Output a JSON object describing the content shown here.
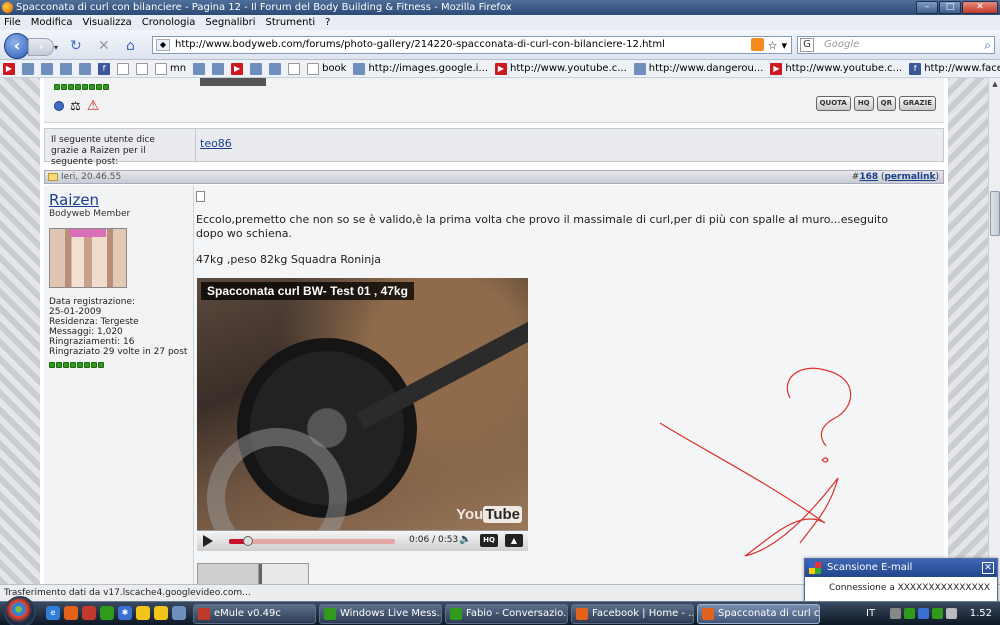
{
  "window": {
    "title": "Spacconata di curl con bilanciere - Pagina 12 - Il Forum del Body Building & Fitness - Mozilla Firefox",
    "controls": [
      "–",
      "□",
      "✕"
    ]
  },
  "menu": [
    {
      "label": "File",
      "key": "F"
    },
    {
      "label": "Modifica",
      "key": "M"
    },
    {
      "label": "Visualizza",
      "key": "V"
    },
    {
      "label": "Cronologia",
      "key": "C"
    },
    {
      "label": "Segnalibri",
      "key": "S"
    },
    {
      "label": "Strumenti",
      "key": "t"
    },
    {
      "label": "?",
      "key": "?"
    }
  ],
  "nav": {
    "url": "http://www.bodyweb.com/forums/photo-gallery/214220-spacconata-di-curl-con-bilanciere-12.html",
    "search_placeholder": "Google",
    "search_engine_icon": "G"
  },
  "bookmarks": [
    {
      "label": "",
      "icon": "yt"
    },
    {
      "label": "",
      "icon": "gen"
    },
    {
      "label": "",
      "icon": "gen"
    },
    {
      "label": "",
      "icon": "gen"
    },
    {
      "label": "",
      "icon": "gen"
    },
    {
      "label": "",
      "icon": "fb"
    },
    {
      "label": "",
      "icon": "page"
    },
    {
      "label": "",
      "icon": "page"
    },
    {
      "label": "mn",
      "icon": "page"
    },
    {
      "label": "",
      "icon": "gen"
    },
    {
      "label": "",
      "icon": "gen"
    },
    {
      "label": "",
      "icon": "yt"
    },
    {
      "label": "",
      "icon": "gen"
    },
    {
      "label": "",
      "icon": "gen"
    },
    {
      "label": "",
      "icon": "page"
    },
    {
      "label": "book",
      "icon": "page"
    },
    {
      "label": "http://images.google.i...",
      "icon": "gen"
    },
    {
      "label": "http://www.youtube.c...",
      "icon": "yt"
    },
    {
      "label": "http://www.dangerou...",
      "icon": "gen"
    },
    {
      "label": "http://www.youtube.c...",
      "icon": "yt"
    },
    {
      "label": "http://www.facebook....",
      "icon": "fb"
    },
    {
      "label": "",
      "icon": "yt"
    }
  ],
  "bookmarks_overflow": "»",
  "prev_post": {
    "buttons": [
      "QUOTA",
      "HQ",
      "QR",
      "GRAZIE"
    ]
  },
  "thanks": {
    "label": "Il seguente utente dice grazie a Raizen per il seguente post:",
    "users": [
      "teo86"
    ]
  },
  "post": {
    "date": "Ieri, 20.46.55",
    "number_prefix": "#",
    "number": "168",
    "permalink": "permalink",
    "username": "Raizen",
    "usertitle": "Bodyweb Member",
    "info": [
      "Data registrazione:",
      "25-01-2009",
      "Residenza: Tergeste",
      "Messaggi: 1,020",
      "Ringraziamenti: 16",
      "Ringraziato 29 volte in 27 post"
    ],
    "reputation_pips": 8,
    "message_line1": "Eccolo,premetto che non so se è valido,è la prima volta che provo il massimale di curl,per di più con spalle al muro...eseguito dopo wo schiena.",
    "message_line2": "47kg ,peso 82kg Squadra Roninja"
  },
  "video": {
    "title": "Spacconata curl BW- Test 01 , 47kg",
    "time": "0:06 / 0:53",
    "progress": 0.113,
    "hq_label": "HQ",
    "logo_you": "You",
    "logo_tube": "Tube"
  },
  "status": {
    "text": "Trasferimento dati da v17.lscache4.googlevideo.com..."
  },
  "notification": {
    "title": "Scansione E-mail",
    "body": "Connessione a XXXXXXXXXXXXXXX"
  },
  "taskbar": {
    "tasks": [
      {
        "label": "eMule v0.49c",
        "color": "#c0392b"
      },
      {
        "label": "Windows Live Mess...",
        "color": "#2f9a1b"
      },
      {
        "label": "Fabio - Conversazio...",
        "color": "#2f9a1b"
      },
      {
        "label": "Facebook | Home - ...",
        "color": "#e2611b"
      },
      {
        "label": "Spacconata di curl c...",
        "color": "#e2611b"
      }
    ],
    "lang": "IT",
    "clock": "1.52"
  }
}
